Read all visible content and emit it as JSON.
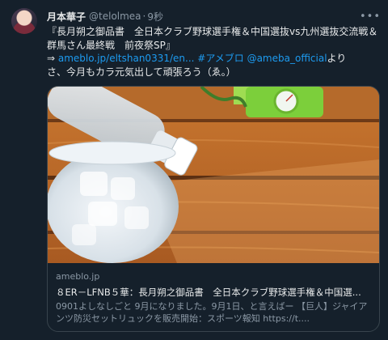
{
  "tweet": {
    "display_name": "月本華子",
    "handle": "@telolmea",
    "separator": "·",
    "time": "9秒",
    "more_label": "•••",
    "text_line1": "『長月朔之御品書　全日本クラブ野球選手権＆中国選抜vs九州選抜交流戦＆群馬さん最終戦　前夜祭SP』",
    "text_arrow": "⇒ ",
    "link_url": "ameblo.jp/eltshan0331/en...",
    "hashtag": "#アメブロ",
    "mention": "@ameba_official",
    "text_yori": "より",
    "text_line3": "さ、今月もカラ元気出して頑張ろう（ゑ。）"
  },
  "card": {
    "domain": "ameblo.jp",
    "title": "８ER－LFNB５華：長月朔之御品書　全日本クラブ野球選手権＆中国選...",
    "description": "0901よしなしごと 9月になりました。9月1日、と言えばー 【巨人】ジャイアンツ防災セットリュックを販売開始：スポーツ報知 https://t...."
  }
}
